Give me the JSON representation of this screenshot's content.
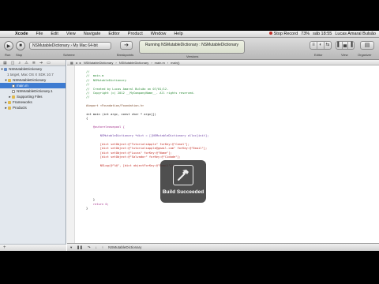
{
  "menubar": {
    "apple": "",
    "items": [
      "Xcode",
      "File",
      "Edit",
      "View",
      "Navigate",
      "Editor",
      "Product",
      "Window",
      "Help"
    ],
    "recording": "Stop Record",
    "status": "73%",
    "clock": "sáb 18:55",
    "user": "Lucas Amaral Bulsão"
  },
  "toolbar": {
    "run_label": "Run",
    "stop_label": "Stop",
    "scheme": "NSMutableDictionary › My Mac 64-bit",
    "scheme_label": "Scheme",
    "breakpoints_label": "Breakpoints",
    "lcd_title": "Running NSMutableDictionary : NSMutableDictionary",
    "lcd_sub": "",
    "editor_label": "Editor",
    "view_label": "View",
    "organizer_label": "Organizer",
    "tabs": [
      "NSMutableDictionary.xcodeproj",
      "main.m"
    ]
  },
  "navigator": {
    "rows": [
      {
        "label": "NSMutableDictionary",
        "sub": "1 target, Mac OS X SDK 10.7",
        "kind": "project",
        "selected": false
      },
      {
        "label": "NSMutableDictionary",
        "kind": "group",
        "selected": false
      },
      {
        "label": "main.m",
        "kind": "file",
        "selected": true
      },
      {
        "label": "NSMutableDictionary.1",
        "kind": "file",
        "selected": false
      },
      {
        "label": "Supporting Files",
        "kind": "group",
        "selected": false
      },
      {
        "label": "Frameworks",
        "kind": "group",
        "selected": false
      },
      {
        "label": "Products",
        "kind": "group",
        "selected": false
      }
    ],
    "bottom": "+"
  },
  "jumpbar": [
    "NSMutableDictionary",
    "NSMutableDictionary",
    "main.m",
    "main()"
  ],
  "code": [
    {
      "t": "//",
      "c": "cmt"
    },
    {
      "t": "//  main.m",
      "c": "cmt"
    },
    {
      "t": "//  NSMutableDictionary",
      "c": "cmt"
    },
    {
      "t": "//",
      "c": "cmt"
    },
    {
      "t": "//  Created by Lucas Amaral Bulsão on 07/01/12.",
      "c": "cmt"
    },
    {
      "t": "//  Copyright (c) 2012 __MyCompanyName__. All rights reserved.",
      "c": "cmt"
    },
    {
      "t": "//",
      "c": "cmt"
    },
    {
      "t": "",
      "c": ""
    },
    {
      "t": "#import <Foundation/Foundation.h>",
      "c": "pp"
    },
    {
      "t": "",
      "c": ""
    },
    {
      "t": "int main (int argc, const char * argv[])",
      "c": ""
    },
    {
      "t": "{",
      "c": ""
    },
    {
      "t": "",
      "c": ""
    },
    {
      "t": "    @autoreleasepool {",
      "c": "kw"
    },
    {
      "t": "",
      "c": ""
    },
    {
      "t": "        NSMutableDictionary *dict = [[NSMutableDictionary alloc]init];",
      "c": "cls"
    },
    {
      "t": "",
      "c": ""
    },
    {
      "t": "        [dict setObject:@\"TutorialsApple\" forKey:@\"Canal\"];",
      "c": "str"
    },
    {
      "t": "        [dict setObject:@\"tutorialsapple@gmail.com\" forKey:@\"Email\"];",
      "c": "str"
    },
    {
      "t": "        [dict setObject:@\"Lucas\" forKey:@\"Nome\"];",
      "c": "str"
    },
    {
      "t": "        [dict setObject:@\"Salvador\" forKey:@\"Cidade\"];",
      "c": "str"
    },
    {
      "t": "",
      "c": ""
    },
    {
      "t": "        NSLog(@\"%@\", [dict objectForKey:@\"Email\"]);",
      "c": "str"
    },
    {
      "t": "",
      "c": ""
    },
    {
      "t": "",
      "c": ""
    },
    {
      "t": "",
      "c": ""
    },
    {
      "t": "",
      "c": ""
    },
    {
      "t": "",
      "c": ""
    },
    {
      "t": "",
      "c": ""
    },
    {
      "t": "",
      "c": ""
    },
    {
      "t": "    }",
      "c": ""
    },
    {
      "t": "    return 0;",
      "c": "kw"
    },
    {
      "t": "}",
      "c": ""
    }
  ],
  "debugbar": "NSMutableDictionary",
  "hud": {
    "label": "Build Succeeded",
    "icon": "hammer-icon"
  },
  "colors": {
    "selection": "#3d7bd1",
    "hud_bg": "#282828"
  }
}
